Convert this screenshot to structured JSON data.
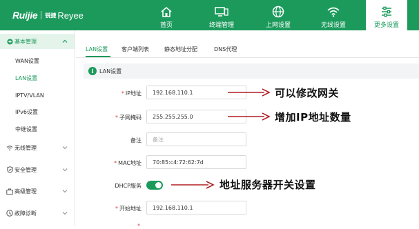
{
  "header": {
    "logo_main": "Ruijie",
    "logo_sub": "锐捷",
    "logo_brand": "Reyee",
    "nav": [
      {
        "label": "首页",
        "icon": "home-icon"
      },
      {
        "label": "终端管理",
        "icon": "monitor-icon"
      },
      {
        "label": "上网设置",
        "icon": "globe-icon"
      },
      {
        "label": "无线设置",
        "icon": "wifi-icon"
      },
      {
        "label": "更多设置",
        "icon": "settings-sliders-icon"
      }
    ]
  },
  "sidebar": {
    "groups": [
      {
        "label": "基本管理",
        "icon": "plus-circle-icon",
        "expanded": true,
        "items": [
          "WAN设置",
          "LAN设置",
          "IPTV/VLAN",
          "IPv6设置",
          "中继设置"
        ]
      },
      {
        "label": "无线管理",
        "icon": "wifi-icon"
      },
      {
        "label": "安全管理",
        "icon": "shield-icon"
      },
      {
        "label": "高级管理",
        "icon": "briefcase-icon"
      },
      {
        "label": "故障诊断",
        "icon": "diagnosis-icon"
      }
    ]
  },
  "tabs": [
    "LAN设置",
    "客户端列表",
    "静态地址分配",
    "DNS代理"
  ],
  "section_title": "LAN设置",
  "form": {
    "ip_label": "IP地址",
    "ip_value": "192.168.110.1",
    "mask_label": "子网掩码",
    "mask_value": "255.255.255.0",
    "remark_label": "备注",
    "remark_placeholder": "备注",
    "mac_label": "MAC地址",
    "mac_value": "70:85:c4:72:62:7d",
    "dhcp_label": "DHCP服务",
    "dhcp_enabled": true,
    "start_label": "开始地址",
    "start_value": "192.168.110.1",
    "required_mark": "*"
  },
  "annotations": {
    "ip": "可以修改网关",
    "mask": "增加IP地址数量",
    "dhcp": "地址服务器开关设置"
  },
  "colors": {
    "accent": "#1b9a5c",
    "required": "#e03b3b",
    "annotation_arrow": "#b01e22"
  }
}
